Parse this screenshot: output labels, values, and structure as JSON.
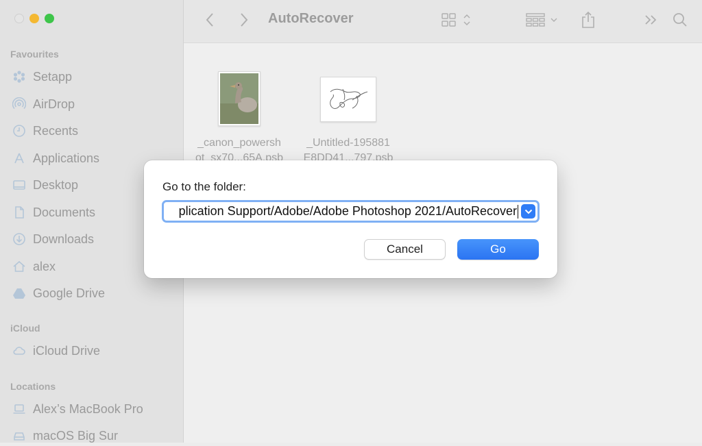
{
  "window": {
    "title": "AutoRecover"
  },
  "sidebar": {
    "sections": [
      {
        "label": "Favourites"
      },
      {
        "label": "iCloud"
      },
      {
        "label": "Locations"
      }
    ],
    "favourites": [
      {
        "label": "Setapp",
        "icon": "setapp-icon"
      },
      {
        "label": "AirDrop",
        "icon": "airdrop-icon"
      },
      {
        "label": "Recents",
        "icon": "clock-icon"
      },
      {
        "label": "Applications",
        "icon": "applications-icon"
      },
      {
        "label": "Desktop",
        "icon": "desktop-icon"
      },
      {
        "label": "Documents",
        "icon": "document-icon"
      },
      {
        "label": "Downloads",
        "icon": "download-icon"
      },
      {
        "label": "alex",
        "icon": "home-icon"
      },
      {
        "label": "Google Drive",
        "icon": "google-drive-icon"
      }
    ],
    "icloud": [
      {
        "label": "iCloud Drive",
        "icon": "cloud-icon"
      }
    ],
    "locations": [
      {
        "label": "Alex’s MacBook Pro",
        "icon": "laptop-icon"
      },
      {
        "label": "macOS Big Sur",
        "icon": "disk-icon"
      }
    ]
  },
  "files": [
    {
      "line1": "_canon_powersh",
      "line2": "ot_sx70...65A.psb"
    },
    {
      "line1": "_Untitled-195881",
      "line2": "E8DD41...797.psb"
    }
  ],
  "dialog": {
    "label": "Go to the folder:",
    "path_value": "plication Support/Adobe/Adobe Photoshop 2021/AutoRecover",
    "cancel_label": "Cancel",
    "go_label": "Go"
  },
  "colors": {
    "accent": "#2f7cf6",
    "focus_ring": "#7fb0f4"
  }
}
